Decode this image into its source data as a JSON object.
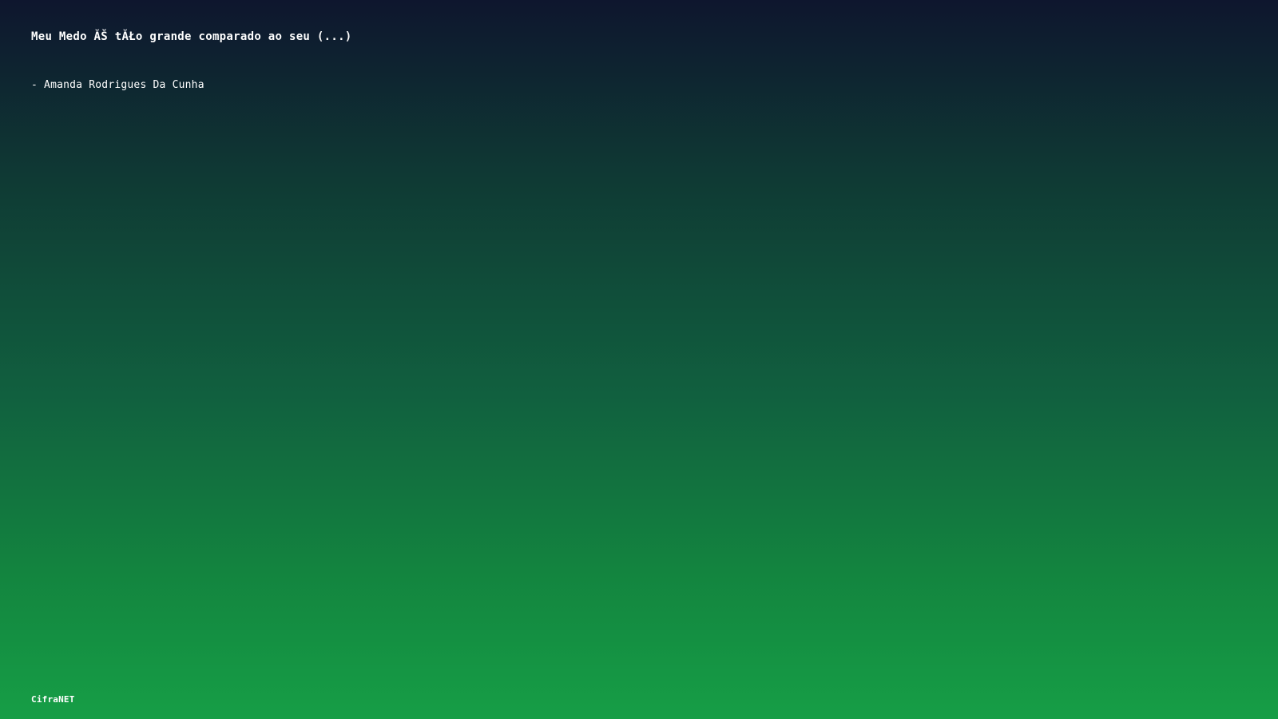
{
  "quote": {
    "text": "Meu Medo ĂŠ tĂŁo grande comparado ao seu (...)"
  },
  "author": {
    "text": "- Amanda Rodrigues Da Cunha"
  },
  "brand": {
    "name": "CifraNET"
  },
  "colors": {
    "gradient_top": "#0e162e",
    "gradient_bottom": "#169e46",
    "text": "#ffffff"
  }
}
